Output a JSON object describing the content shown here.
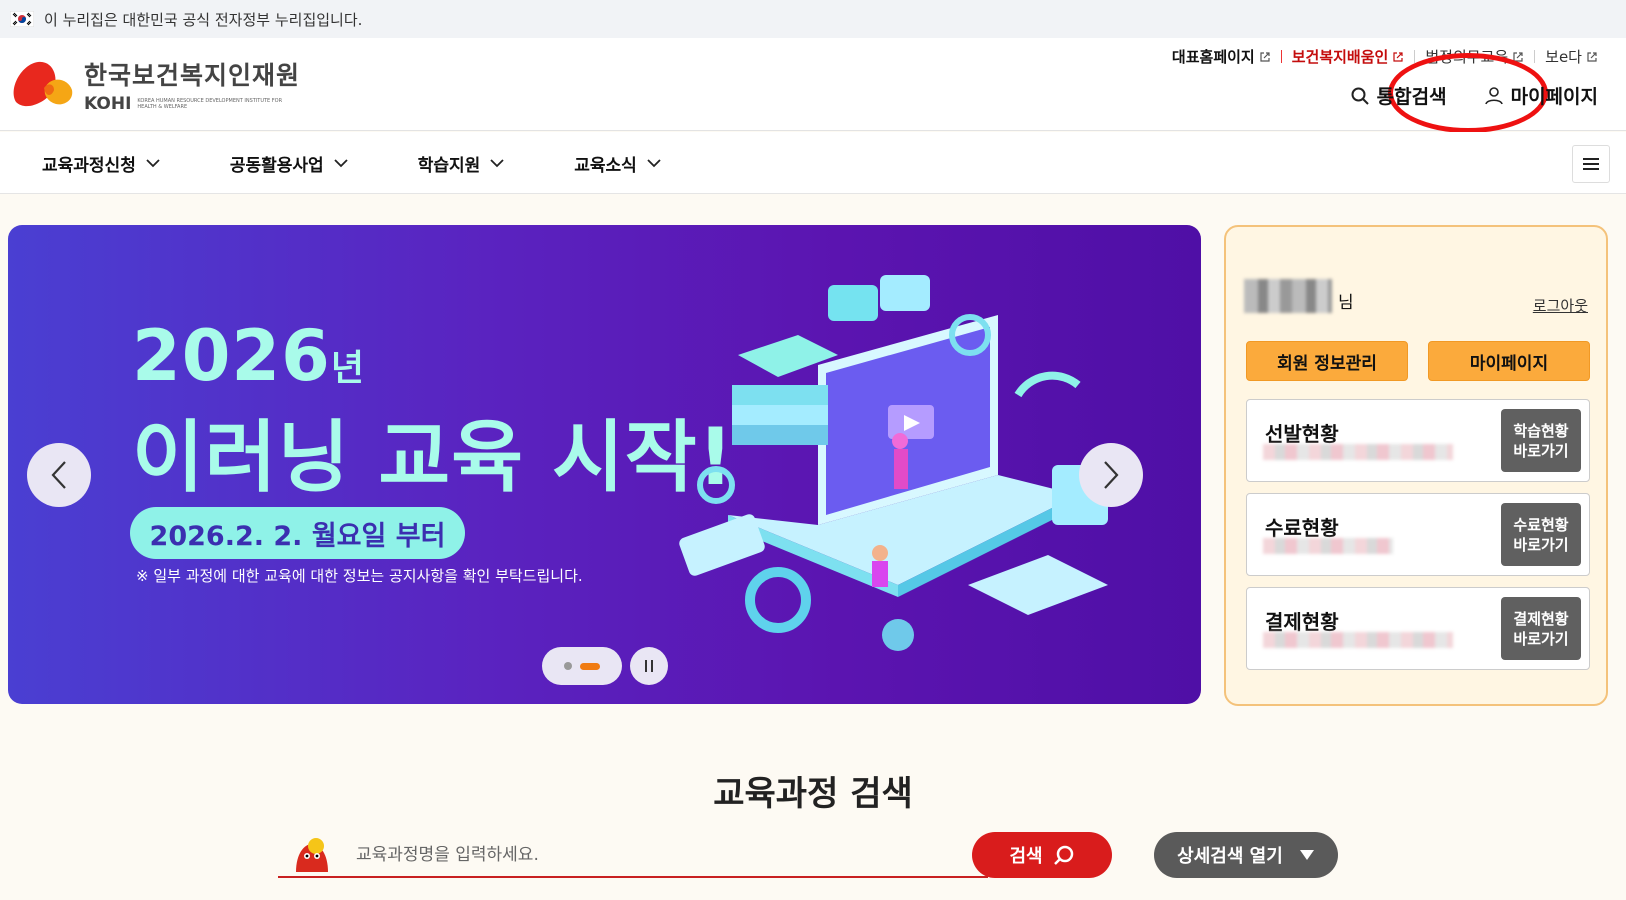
{
  "gov_bar": {
    "text": "이 누리집은 대한민국 공식 전자정부 누리집입니다."
  },
  "logo": {
    "ko": "한국보건복지인재원",
    "en": "KOHI",
    "sub": "KOREA HUMAN RESOURCE DEVELOPMENT INSTITUTE FOR HEALTH & WELFARE"
  },
  "top_links": [
    {
      "label": "대표홈페이지"
    },
    {
      "label": "보건복지배움인"
    },
    {
      "label": "법정의무교육"
    },
    {
      "label": "보e다"
    }
  ],
  "utility": {
    "search": "통합검색",
    "mypage": "마이페이지"
  },
  "nav": {
    "items": [
      "교육과정신청",
      "공동활용사업",
      "학습지원",
      "교육소식"
    ]
  },
  "banner": {
    "year": "2026",
    "year_suffix": "년",
    "headline": "이러닝 교육 시작!",
    "date": "2026.2. 2. 월요일 부터",
    "note": "※ 일부 과정에 대한 교육에 대한 정보는 공지사항을 확인 부탁드립니다."
  },
  "panel": {
    "name_suffix": "님",
    "logout": "로그아웃",
    "btn_member": "회원 정보관리",
    "btn_mypage": "마이페이지",
    "cards": [
      {
        "title": "선발현황",
        "go": "학습현황\n바로가기",
        "go1": "학습현황",
        "go2": "바로가기"
      },
      {
        "title": "수료현황",
        "go1": "수료현황",
        "go2": "바로가기"
      },
      {
        "title": "결제현황",
        "go1": "결제현황",
        "go2": "바로가기"
      }
    ]
  },
  "search": {
    "title": "교육과정 검색",
    "placeholder": "교육과정명을 입력하세요.",
    "button": "검색",
    "advanced": "상세검색 열기"
  },
  "colors": {
    "accent_red": "#d91c1c",
    "banner_purple": "#5a23c0",
    "panel_orange": "#fbaa3c",
    "annotation_circle": "#ee1111"
  }
}
